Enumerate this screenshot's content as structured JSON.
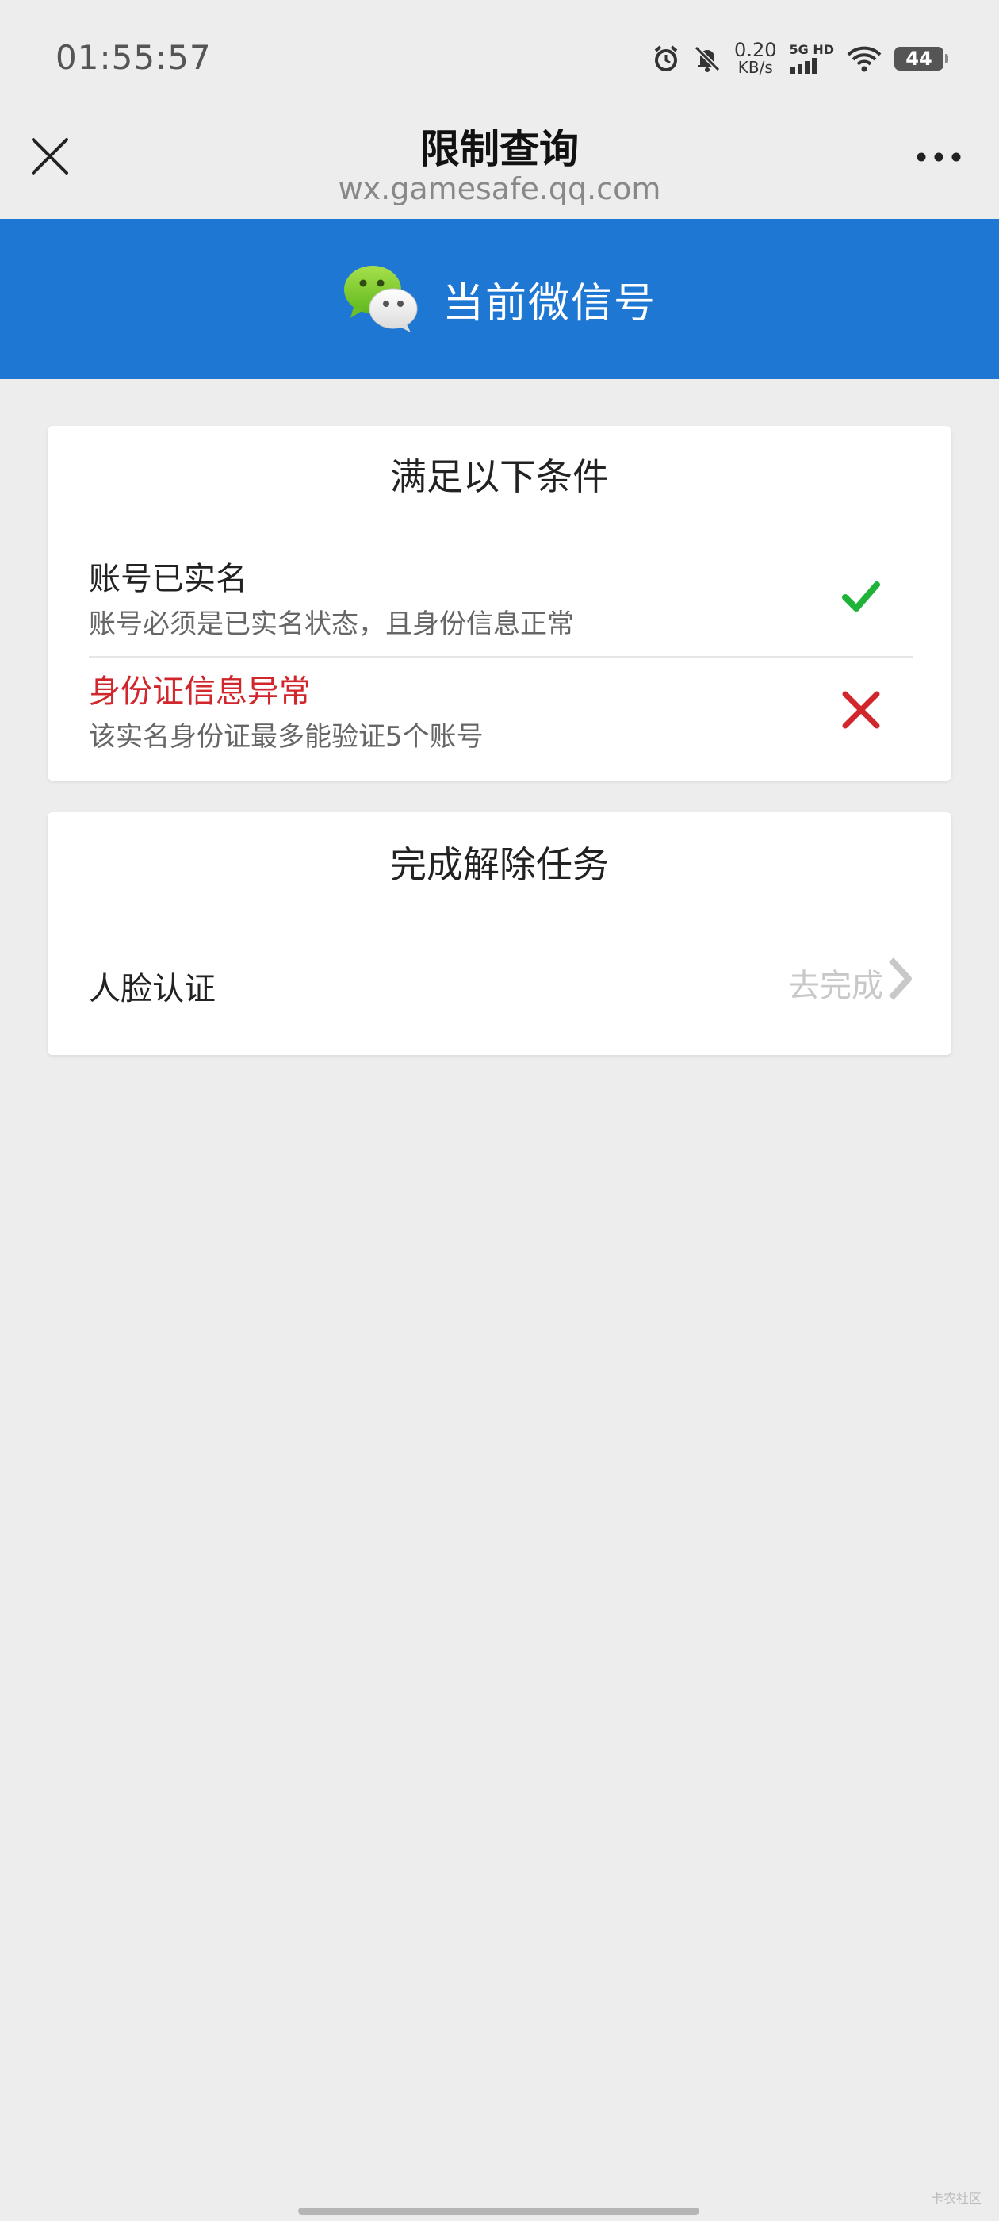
{
  "status_bar": {
    "time": "01:55:57",
    "net_speed_value": "0.20",
    "net_speed_unit": "KB/s",
    "signal_label": "5G HD",
    "battery": "44",
    "icons": [
      "alarm-icon",
      "mute-bell-icon",
      "signal-icon",
      "wifi-icon",
      "battery-icon"
    ]
  },
  "header": {
    "title": "限制查询",
    "url": "wx.gamesafe.qq.com",
    "close_icon": "close-icon",
    "more_icon": "more-icon"
  },
  "banner": {
    "icon": "wechat-logo-icon",
    "text": "当前微信号",
    "color": "#1e77d2"
  },
  "conditions": {
    "title": "满足以下条件",
    "items": [
      {
        "title": "账号已实名",
        "desc": "账号必须是已实名状态，且身份信息正常",
        "status": "ok",
        "icon": "check-icon",
        "color": "#1fb33a"
      },
      {
        "title": "身份证信息异常",
        "desc": "该实名身份证最多能验证5个账号",
        "status": "error",
        "icon": "cross-icon",
        "color": "#d0262c"
      }
    ]
  },
  "tasks": {
    "title": "完成解除任务",
    "items": [
      {
        "label": "人脸认证",
        "action": "去完成",
        "icon": "chevron-right-icon"
      }
    ]
  },
  "watermark": "卡农社区"
}
